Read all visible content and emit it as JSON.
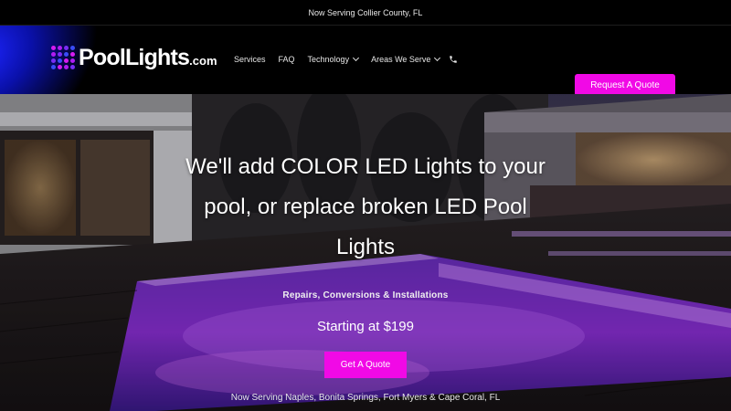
{
  "announcement": "Now Serving Collier County, FL",
  "logo": {
    "text": "PoolLights",
    "suffix": ".com",
    "dot_colors": [
      "#d61cf0",
      "#b01cf2",
      "#7a2cf5",
      "#3a4cf7"
    ]
  },
  "nav": {
    "items": [
      {
        "label": "Services"
      },
      {
        "label": "FAQ"
      },
      {
        "label": "Technology"
      },
      {
        "label": "Areas We Serve"
      }
    ],
    "phone_icon": "phone-icon"
  },
  "header_cta": "Request A Quote",
  "hero": {
    "headline": "We'll add COLOR LED Lights to your pool, or replace broken LED Pool Lights",
    "subheading": "Repairs, Conversions & Installations",
    "price": "Starting at $199",
    "cta": "Get A Quote",
    "areas": "Now Serving Naples, Bonita Springs, Fort Myers & Cape Coral, FL"
  },
  "colors": {
    "accent": "#f109e6",
    "header_bg": "#000000",
    "glow": "#1d25ff"
  }
}
